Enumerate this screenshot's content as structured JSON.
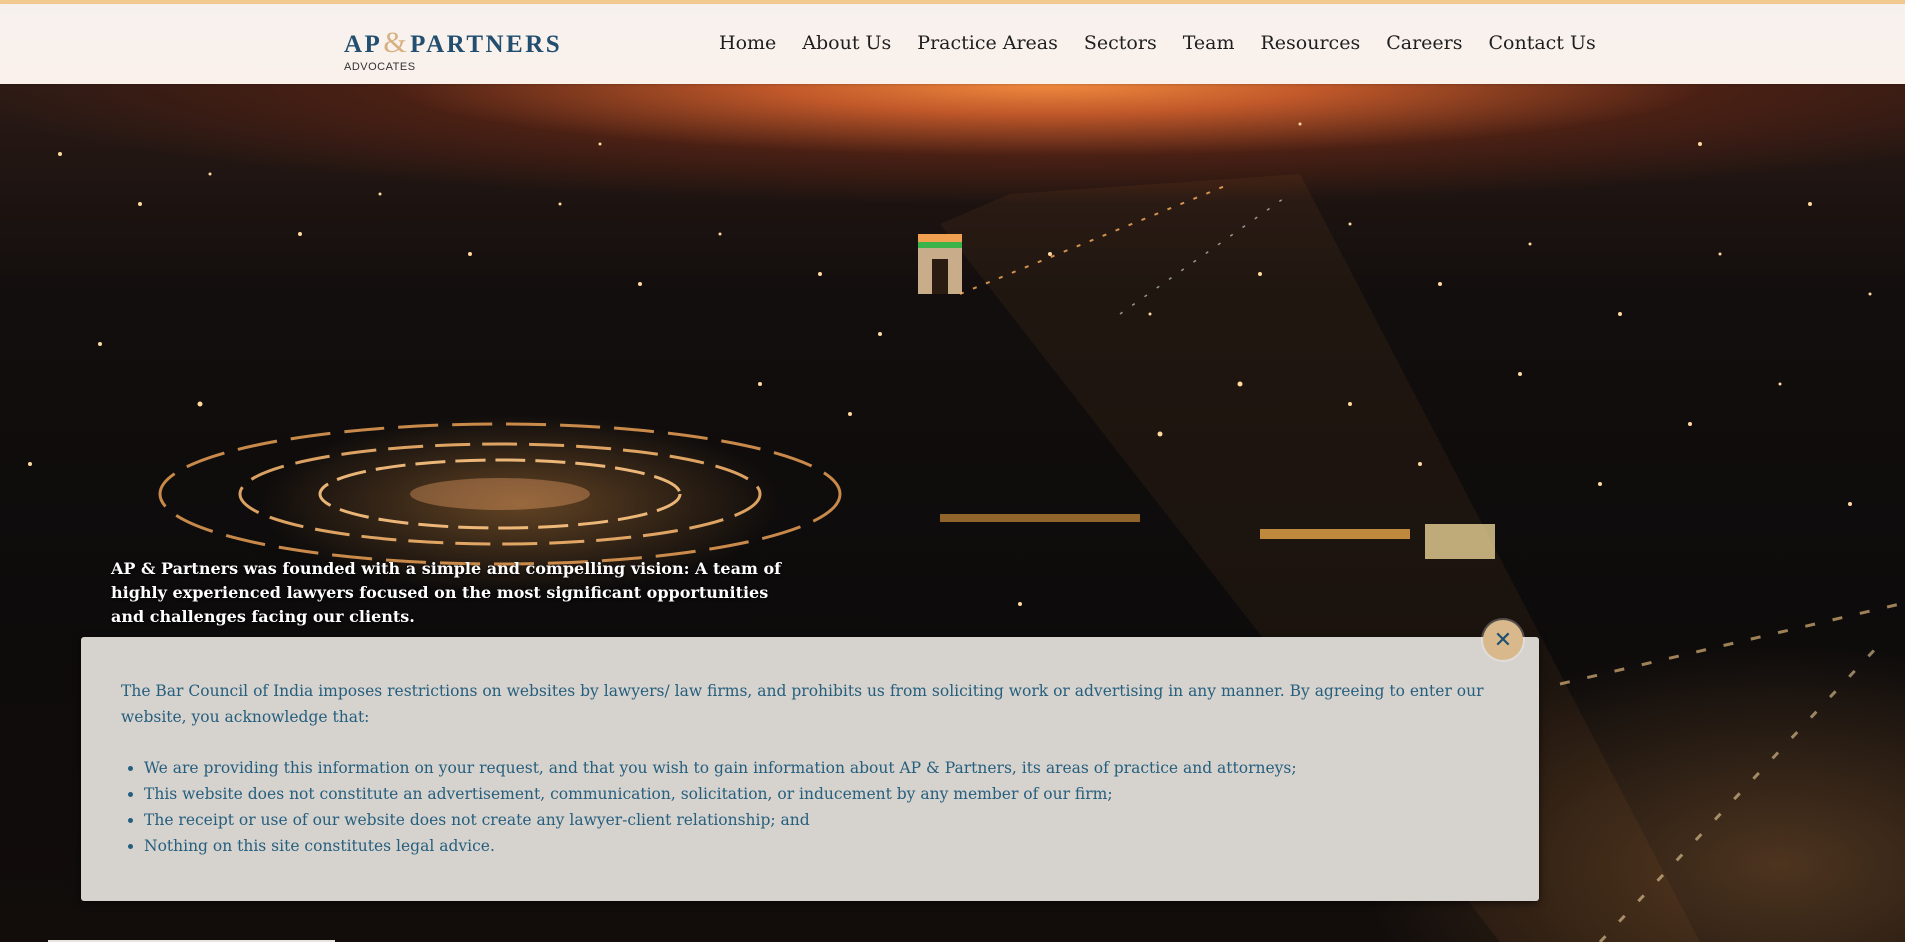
{
  "brand": {
    "name_left": "AP",
    "ampersand": "&",
    "name_right": "PARTNERS",
    "subtitle": "ADVOCATES"
  },
  "nav": {
    "items": [
      {
        "label": "Home"
      },
      {
        "label": "About Us"
      },
      {
        "label": "Practice Areas"
      },
      {
        "label": "Sectors"
      },
      {
        "label": "Team"
      },
      {
        "label": "Resources"
      },
      {
        "label": "Careers"
      },
      {
        "label": "Contact Us"
      }
    ]
  },
  "hero": {
    "tagline": "AP & Partners was founded with a simple and compelling vision: A team of highly experienced lawyers focused on the most significant opportunities and challenges facing our clients."
  },
  "disclaimer": {
    "intro": "The Bar Council of India imposes restrictions on websites by lawyers/ law firms, and prohibits us from soliciting work or advertising in any manner. By agreeing to enter our website, you acknowledge that:",
    "points": [
      "We are providing this information on your request, and that you wish to gain information about AP & Partners, its areas of practice and attorneys;",
      "This website does not constitute an advertisement, communication, solicitation, or inducement by any member of our firm;",
      "The receipt or use of our website does not create any lawyer-client relationship; and",
      "Nothing on this site constitutes legal advice."
    ],
    "close_icon": "close-icon"
  },
  "colors": {
    "brand_blue": "#224e70",
    "brand_gold": "#d6b081",
    "modal_text": "#255f7e",
    "modal_bg": "#d6d2ce"
  }
}
